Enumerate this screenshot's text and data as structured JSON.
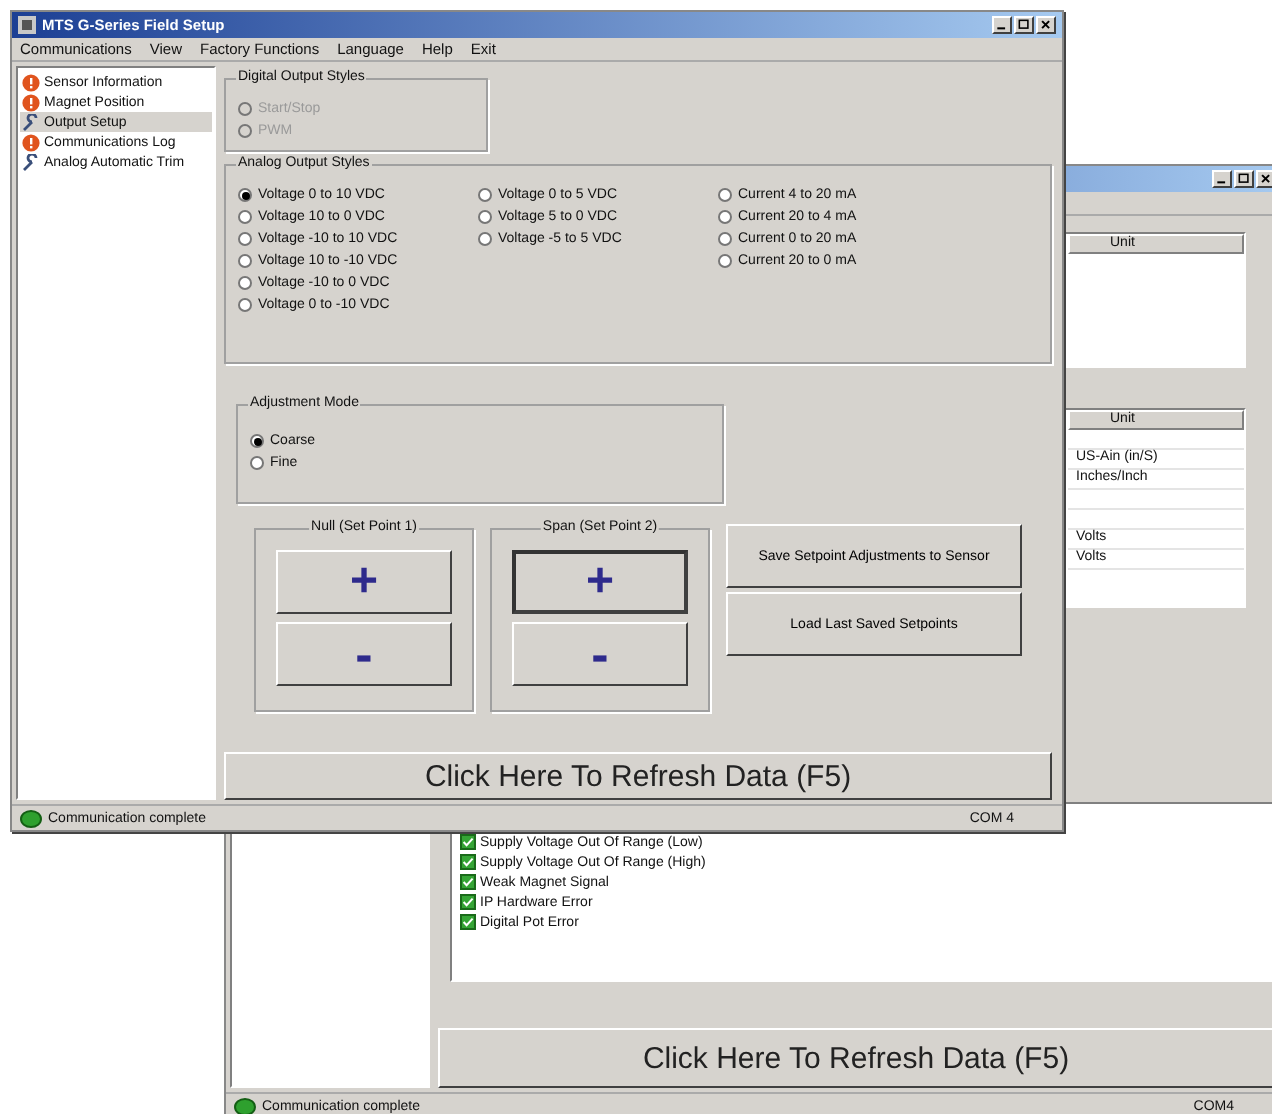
{
  "front_window": {
    "title": "MTS G-Series Field Setup",
    "menu": [
      "Communications",
      "View",
      "Factory Functions",
      "Language",
      "Help",
      "Exit"
    ],
    "nav": [
      {
        "label": "Sensor Information",
        "kind": "warning",
        "selected": false
      },
      {
        "label": "Magnet Position",
        "kind": "warning",
        "selected": false
      },
      {
        "label": "Output Setup",
        "kind": "tool",
        "selected": true
      },
      {
        "label": "Communications Log",
        "kind": "warning",
        "selected": false
      },
      {
        "label": "Analog Automatic Trim",
        "kind": "tool",
        "selected": false
      }
    ],
    "digital_output": {
      "title": "Digital Output Styles",
      "options": [
        {
          "label": "Start/Stop",
          "selected": false,
          "disabled": true
        },
        {
          "label": "PWM",
          "selected": false,
          "disabled": true
        }
      ]
    },
    "analog_output": {
      "title": "Analog Output Styles",
      "columns": [
        [
          {
            "label": "Voltage 0 to 10 VDC",
            "selected": true
          },
          {
            "label": "Voltage 10 to 0 VDC",
            "selected": false
          },
          {
            "label": "Voltage -10 to 10 VDC",
            "selected": false
          },
          {
            "label": "Voltage 10 to -10 VDC",
            "selected": false
          },
          {
            "label": "Voltage -10 to 0 VDC",
            "selected": false
          },
          {
            "label": "Voltage 0 to -10 VDC",
            "selected": false
          }
        ],
        [
          {
            "label": "Voltage 0 to 5 VDC",
            "selected": false
          },
          {
            "label": "Voltage 5 to 0 VDC",
            "selected": false
          },
          {
            "label": "Voltage -5 to 5 VDC",
            "selected": false
          }
        ],
        [
          {
            "label": "Current 4 to 20 mA",
            "selected": false
          },
          {
            "label": "Current 20 to 4 mA",
            "selected": false
          },
          {
            "label": "Current 0 to 20 mA",
            "selected": false
          },
          {
            "label": "Current 20 to 0 mA",
            "selected": false
          }
        ]
      ]
    },
    "adjustment_mode": {
      "title": "Adjustment Mode",
      "options": [
        {
          "label": "Coarse",
          "selected": true
        },
        {
          "label": "Fine",
          "selected": false
        }
      ]
    },
    "setpoints": [
      {
        "title": "Null (Set Point 1)",
        "buttons": [
          {
            "label": "+",
            "focused": false
          },
          {
            "label": "-",
            "focused": false
          }
        ]
      },
      {
        "title": "Span (Set Point 2)",
        "buttons": [
          {
            "label": "+",
            "focused": true
          },
          {
            "label": "-",
            "focused": false
          }
        ]
      }
    ],
    "actions": [
      "Save Setpoint Adjustments to Sensor",
      "Load Last Saved Setpoints"
    ],
    "refresh": "Click Here To Refresh Data (F5)",
    "status_bar": {
      "text": "Communication complete",
      "port": "COM 4"
    }
  },
  "back_window": {
    "table_1": {
      "header": "Unit"
    },
    "table_2": {
      "header": "Unit",
      "rows": [
        {
          "unit": "US-Ain (in/S)"
        },
        {
          "unit": "Inches/Inch"
        },
        {
          "unit": "Volts"
        },
        {
          "unit": "Volts"
        }
      ]
    },
    "log": [
      "Supply Voltage Out Of Range (Low)",
      "Supply Voltage Out Of Range (High)",
      "Weak Magnet Signal",
      "IP Hardware Error",
      "Digital Pot Error"
    ],
    "refresh": "Click Here To Refresh Data (F5)",
    "status_bar": {
      "text": "Communication complete",
      "port": "COM4"
    }
  }
}
